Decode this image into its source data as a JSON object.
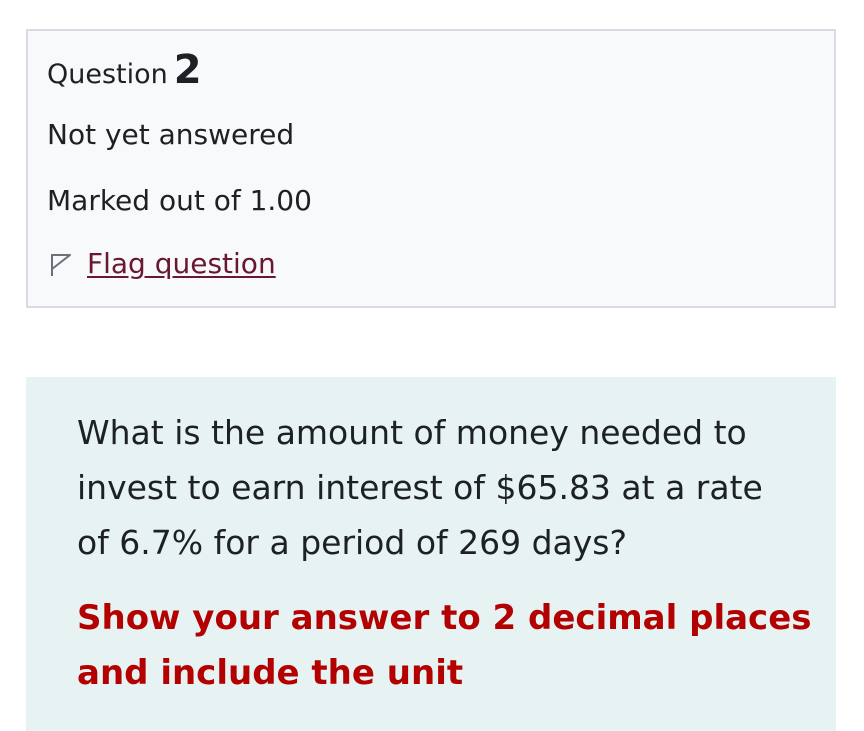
{
  "question_info": {
    "label": "Question",
    "number": "2",
    "state": "Not yet answered",
    "grade": "Marked out of 1.00",
    "flag_label": "Flag question",
    "flag_icon": "flag-outline-icon"
  },
  "question": {
    "text": "What is the amount of money needed to invest to earn interest of $65.83 at a rate of 6.7% for a period of 269 days?",
    "instruction": "Show your answer to 2 decimal places and include the unit"
  },
  "colors": {
    "info_background": "#f8f9fa",
    "info_border": "#d8dbe2",
    "question_background": "#e7f2f3",
    "link": "#6a1732",
    "instruction": "#b30000",
    "text": "#1d2125"
  }
}
